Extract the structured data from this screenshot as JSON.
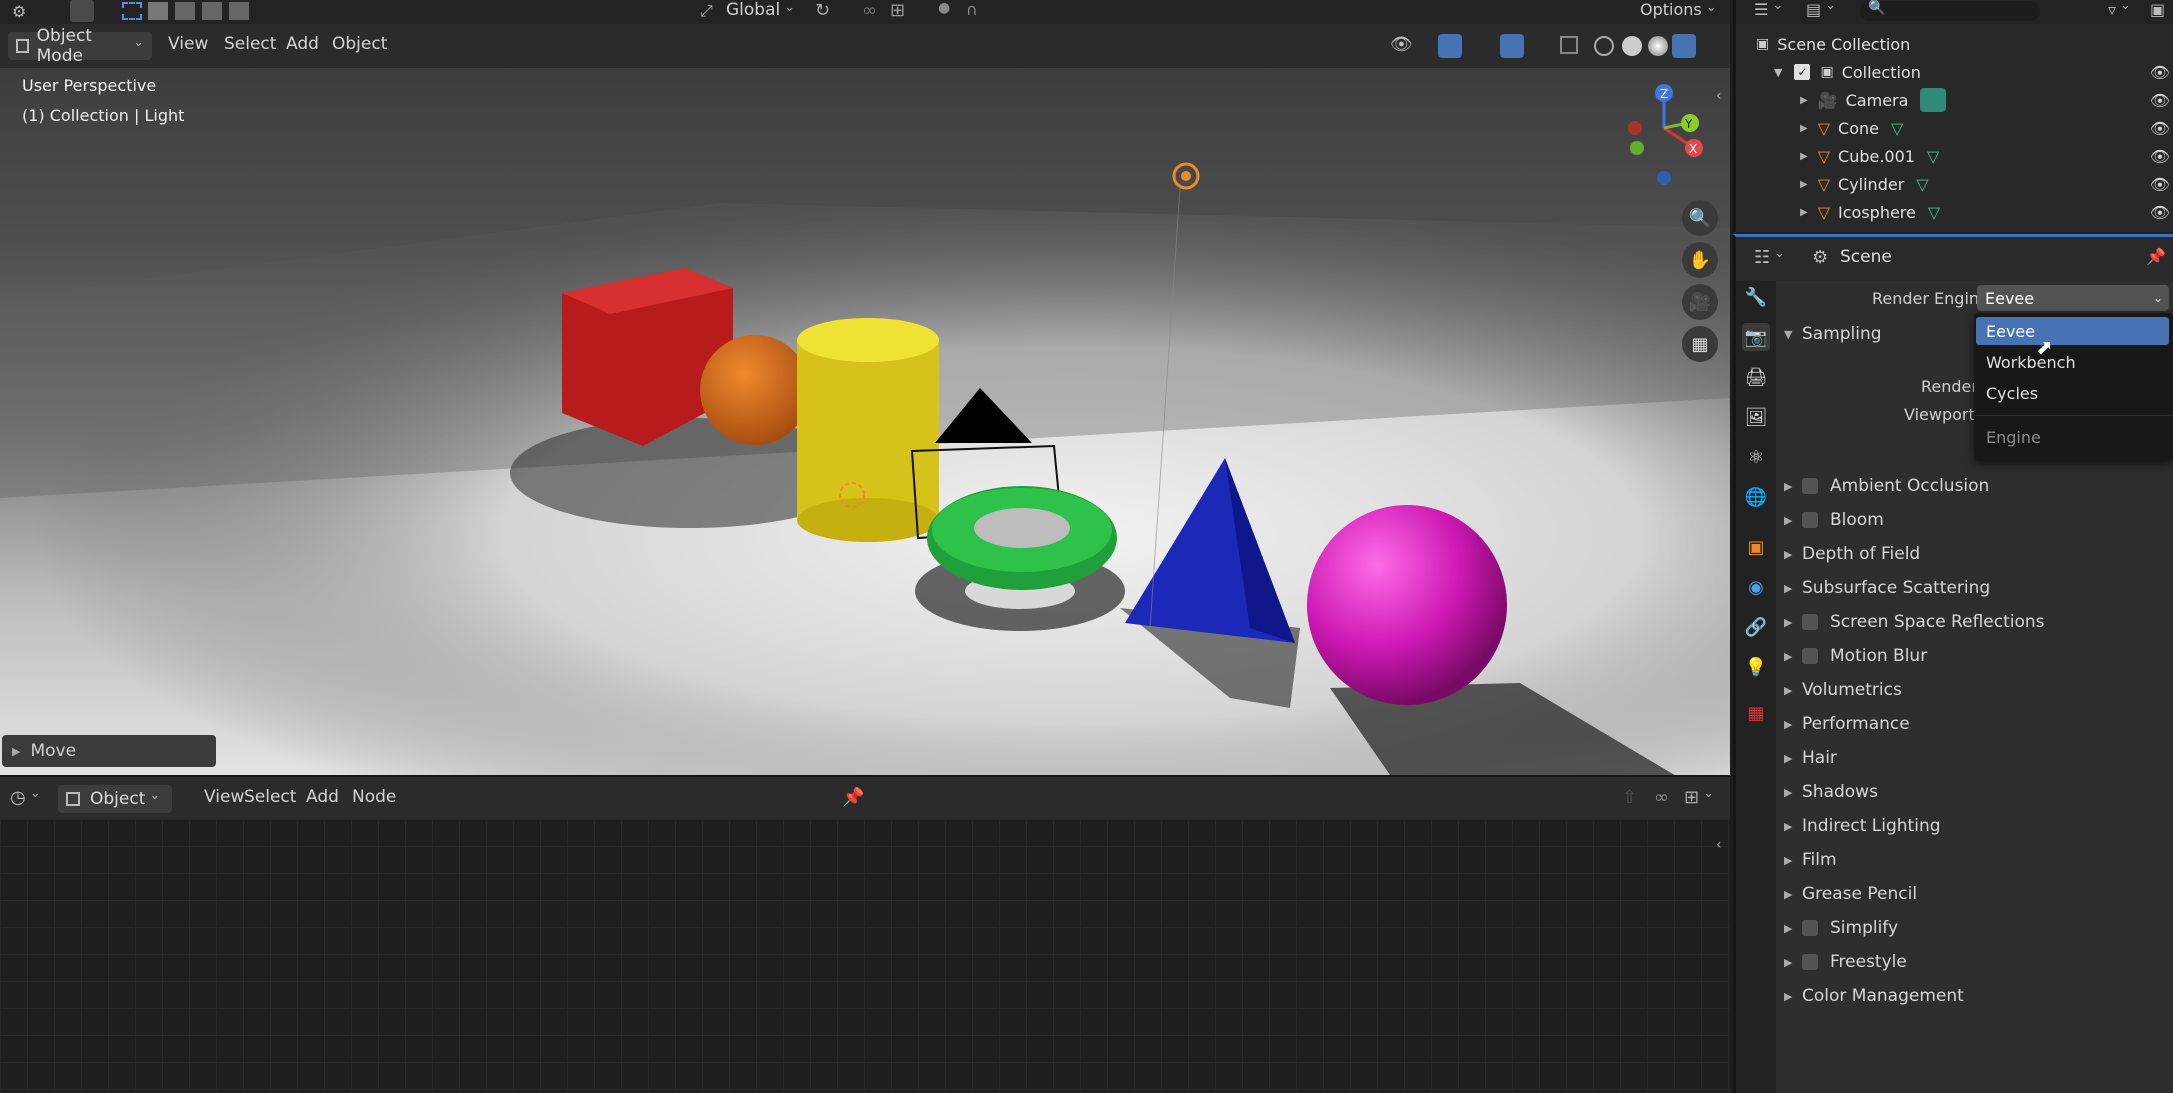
{
  "toolbar": {
    "transform_orientation": "Global",
    "options_label": "Options"
  },
  "viewport_header": {
    "mode": "Object Mode",
    "menus": [
      "View",
      "Select",
      "Add",
      "Object"
    ]
  },
  "viewport": {
    "perspective_label": "User Perspective",
    "context_label": "(1) Collection | Light",
    "last_op_panel": "Move"
  },
  "node_header": {
    "type": "Object",
    "menus": [
      "View",
      "Select",
      "Add",
      "Node"
    ]
  },
  "outliner": {
    "root": "Scene Collection",
    "collection": "Collection",
    "items": [
      {
        "name": "Camera",
        "icon": "camera-icon"
      },
      {
        "name": "Cone",
        "icon": "mesh-icon"
      },
      {
        "name": "Cube.001",
        "icon": "mesh-icon"
      },
      {
        "name": "Cylinder",
        "icon": "mesh-icon"
      },
      {
        "name": "Icosphere",
        "icon": "mesh-icon"
      }
    ]
  },
  "properties": {
    "context": "Scene",
    "render_engine_label": "Render Engine",
    "render_engine_value": "Eevee",
    "sampling_label": "Sampling",
    "render_label": "Render",
    "viewport_label": "Viewport",
    "engine_options": [
      "Eevee",
      "Workbench",
      "Cycles"
    ],
    "engine_menu_title": "Engine",
    "panels": [
      {
        "label": "Ambient Occlusion",
        "checkbox": true
      },
      {
        "label": "Bloom",
        "checkbox": true
      },
      {
        "label": "Depth of Field",
        "checkbox": false
      },
      {
        "label": "Subsurface Scattering",
        "checkbox": false
      },
      {
        "label": "Screen Space Reflections",
        "checkbox": true
      },
      {
        "label": "Motion Blur",
        "checkbox": true
      },
      {
        "label": "Volumetrics",
        "checkbox": false
      },
      {
        "label": "Performance",
        "checkbox": false
      },
      {
        "label": "Hair",
        "checkbox": false
      },
      {
        "label": "Shadows",
        "checkbox": false
      },
      {
        "label": "Indirect Lighting",
        "checkbox": false
      },
      {
        "label": "Film",
        "checkbox": false
      },
      {
        "label": "Grease Pencil",
        "checkbox": false
      },
      {
        "label": "Simplify",
        "checkbox": true
      },
      {
        "label": "Freestyle",
        "checkbox": true
      },
      {
        "label": "Color Management",
        "checkbox": false
      }
    ]
  },
  "colors": {
    "accent": "#4772b3",
    "mesh_icon": "#e98b2a",
    "data_icon": "#3ec28f"
  }
}
